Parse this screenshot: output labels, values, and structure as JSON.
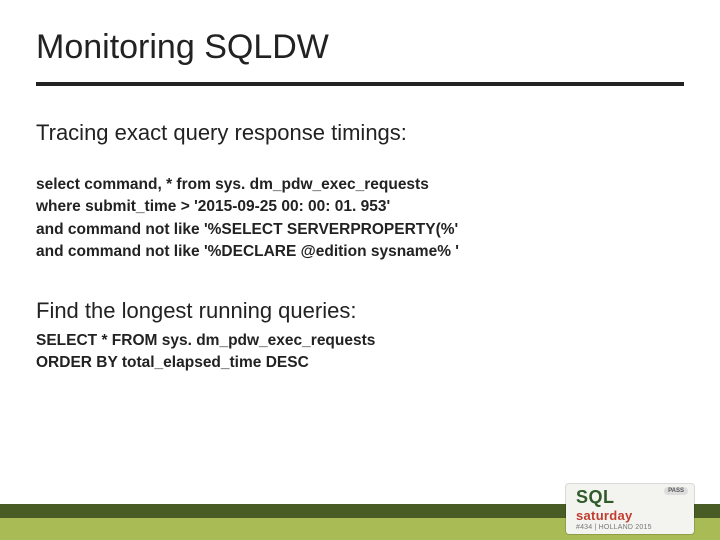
{
  "title": "Monitoring SQLDW",
  "sub1": "Tracing exact query response timings:",
  "code1": "select command, * from sys. dm_pdw_exec_requests\nwhere submit_time > '2015-09-25 00: 00: 01. 953'\nand command not like '%SELECT SERVERPROPERTY(%'\nand command not like '%DECLARE @edition sysname% '",
  "sub2": "Find the longest running queries:",
  "code2": "SELECT * FROM sys. dm_pdw_exec_requests\nORDER BY total_elapsed_time DESC",
  "logo": {
    "pass": "PASS",
    "sql": "SQL",
    "sat": "saturday",
    "tag": "#434 | HOLLAND 2015"
  }
}
